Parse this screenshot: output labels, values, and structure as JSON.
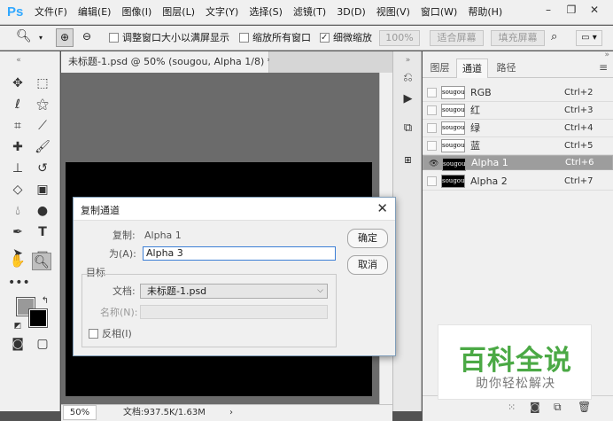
{
  "menubar": {
    "logo": "Ps",
    "items": [
      "文件(F)",
      "编辑(E)",
      "图像(I)",
      "图层(L)",
      "文字(Y)",
      "选择(S)",
      "滤镜(T)",
      "3D(D)",
      "视图(V)",
      "窗口(W)",
      "帮助(H)"
    ]
  },
  "options": {
    "resize_windows": "调整窗口大小以满屏显示",
    "zoom_all": "缩放所有窗口",
    "scrubby_zoom": "细微缩放",
    "btn_100": "100%",
    "btn_fit": "适合屏幕",
    "btn_fill": "填充屏幕"
  },
  "document": {
    "tab_title": "未标题-1.psd @ 50% (sougou, Alpha 1/8) *",
    "zoom": "50%",
    "doc_size": "文档:937.5K/1.63M"
  },
  "channels_panel": {
    "tabs": [
      "图层",
      "通道",
      "路径"
    ],
    "active_tab": "通道",
    "channels": [
      {
        "name": "RGB",
        "shortcut": "Ctrl+2",
        "thumb": "sougou",
        "visible": false,
        "selected": false
      },
      {
        "name": "红",
        "shortcut": "Ctrl+3",
        "thumb": "sougou",
        "visible": false,
        "selected": false
      },
      {
        "name": "绿",
        "shortcut": "Ctrl+4",
        "thumb": "sougou",
        "visible": false,
        "selected": false
      },
      {
        "name": "蓝",
        "shortcut": "Ctrl+5",
        "thumb": "sougou",
        "visible": false,
        "selected": false
      },
      {
        "name": "Alpha 1",
        "shortcut": "Ctrl+6",
        "thumb": "sougou",
        "visible": true,
        "selected": true
      },
      {
        "name": "Alpha 2",
        "shortcut": "Ctrl+7",
        "thumb": "sougou",
        "visible": false,
        "selected": false
      }
    ]
  },
  "dialog": {
    "title": "复制通道",
    "copy_label": "复制:",
    "copy_value": "Alpha 1",
    "as_label": "为(A):",
    "as_value": "Alpha 3",
    "target_group": "目标",
    "doc_label": "文档:",
    "doc_value": "未标题-1.psd",
    "name_label": "名称(N):",
    "name_value": "",
    "invert_label": "反相(I)",
    "ok": "确定",
    "cancel": "取消"
  },
  "watermark": {
    "line1": "百科全说",
    "line2": "助你轻松解决"
  }
}
